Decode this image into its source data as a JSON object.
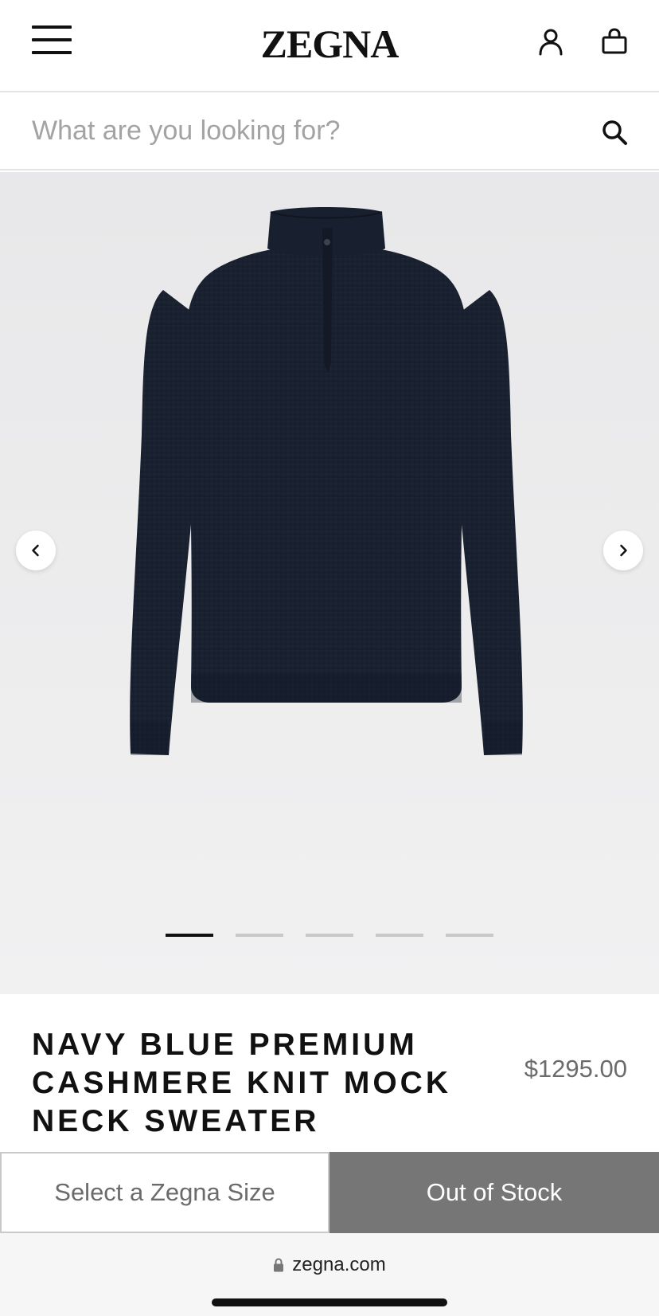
{
  "header": {
    "logo": "ZEGNA",
    "menu_icon": "hamburger-menu-icon",
    "account_icon": "user-icon",
    "bag_icon": "shopping-bag-icon"
  },
  "search": {
    "placeholder": "What are you looking for?",
    "icon": "search-icon"
  },
  "gallery": {
    "image": "navy blue mock neck sweater product photo",
    "prev_icon": "chevron-left-icon",
    "next_icon": "chevron-right-icon",
    "slide_count": 5,
    "active_slide": 1,
    "background": "#ececed",
    "garment_color": "#1b2433"
  },
  "product": {
    "title": "NAVY BLUE PREMIUM CASHMERE KNIT MOCK NECK SWEATER",
    "price": "$1295.00"
  },
  "actions": {
    "size_label": "Select a Zegna Size",
    "stock_label": "Out of Stock",
    "stock_color": "#767676"
  },
  "browser": {
    "url": "zegna.com",
    "lock_icon": "lock-icon"
  }
}
